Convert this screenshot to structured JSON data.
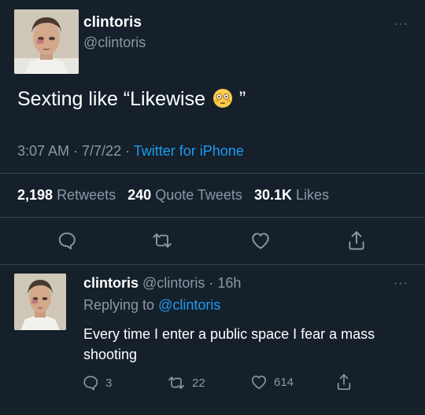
{
  "tweet": {
    "author_name": "clintoris",
    "author_handle": "@clintoris",
    "more": "···",
    "text_before": "Sexting like “Likewise",
    "text_after": "”",
    "emoji": "flushed-face",
    "time": "3:07 AM · 7/7/22 · ",
    "source": "Twitter for iPhone",
    "stats": {
      "retweets_count": "2,198",
      "retweets_label": "Retweets",
      "quotes_count": "240",
      "quotes_label": "Quote Tweets",
      "likes_count": "30.1K",
      "likes_label": "Likes"
    },
    "actions": [
      "reply-icon",
      "retweet-icon",
      "like-icon",
      "share-icon"
    ]
  },
  "reply": {
    "author_name": "clintoris",
    "author_handle": "@clintoris",
    "age": "· 16h",
    "more": "···",
    "replying_prefix": "Replying to ",
    "replying_to": "@clintoris",
    "text": "Every time I enter a public space I fear a mass shooting",
    "reply_count": "3",
    "retweet_count": "22",
    "like_count": "614"
  },
  "colors": {
    "background": "#15202b",
    "text": "#ffffff",
    "secondary": "#8b98a5",
    "link": "#1d9bf0",
    "divider": "#38444d"
  }
}
